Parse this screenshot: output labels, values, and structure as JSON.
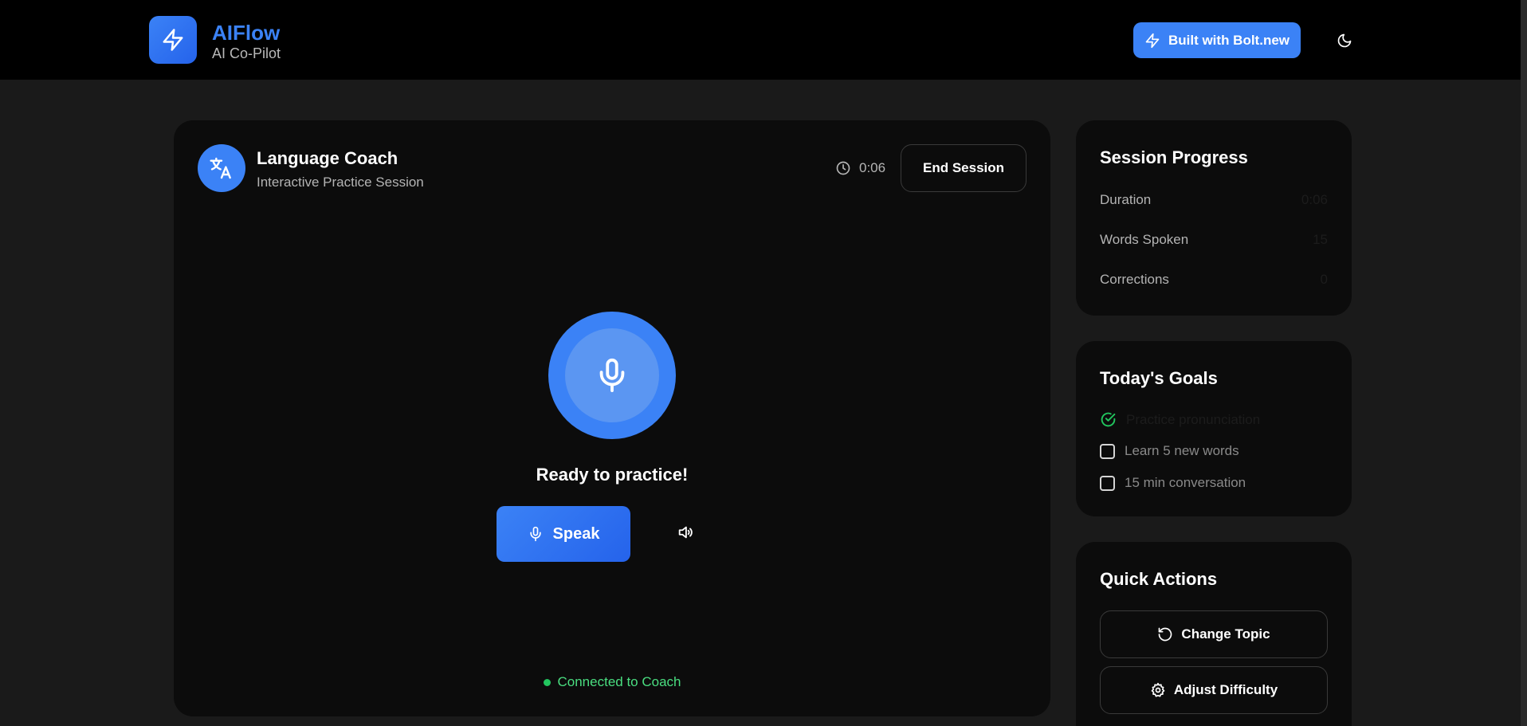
{
  "header": {
    "brand_name": "AIFlow",
    "brand_tagline": "AI Co-Pilot",
    "built_with_label": "Built with Bolt.new",
    "logo_icon": "lightning-bolt-icon",
    "theme_icon": "moon-icon"
  },
  "session": {
    "title": "Language Coach",
    "subtitle": "Interactive Practice Session",
    "timer": "0:06",
    "end_label": "End Session",
    "ready_text": "Ready to practice!",
    "speak_label": "Speak",
    "status_text": "Connected to Coach",
    "avatar_icon": "translate-icon"
  },
  "progress": {
    "title": "Session Progress",
    "stats": [
      {
        "label": "Duration",
        "value": "0:06"
      },
      {
        "label": "Words Spoken",
        "value": "15"
      },
      {
        "label": "Corrections",
        "value": "0"
      }
    ]
  },
  "goals": {
    "title": "Today's Goals",
    "items": [
      {
        "label": "Practice pronunciation",
        "done": true
      },
      {
        "label": "Learn 5 new words",
        "done": false
      },
      {
        "label": "15 min conversation",
        "done": false
      }
    ]
  },
  "actions": {
    "title": "Quick Actions",
    "items": [
      {
        "label": "Change Topic",
        "icon": "rotate-ccw-icon"
      },
      {
        "label": "Adjust Difficulty",
        "icon": "gear-icon"
      }
    ]
  },
  "colors": {
    "accent": "#3b82f6",
    "success": "#22c55e",
    "background": "#1a1a1a",
    "card": "#0c0c0c"
  }
}
